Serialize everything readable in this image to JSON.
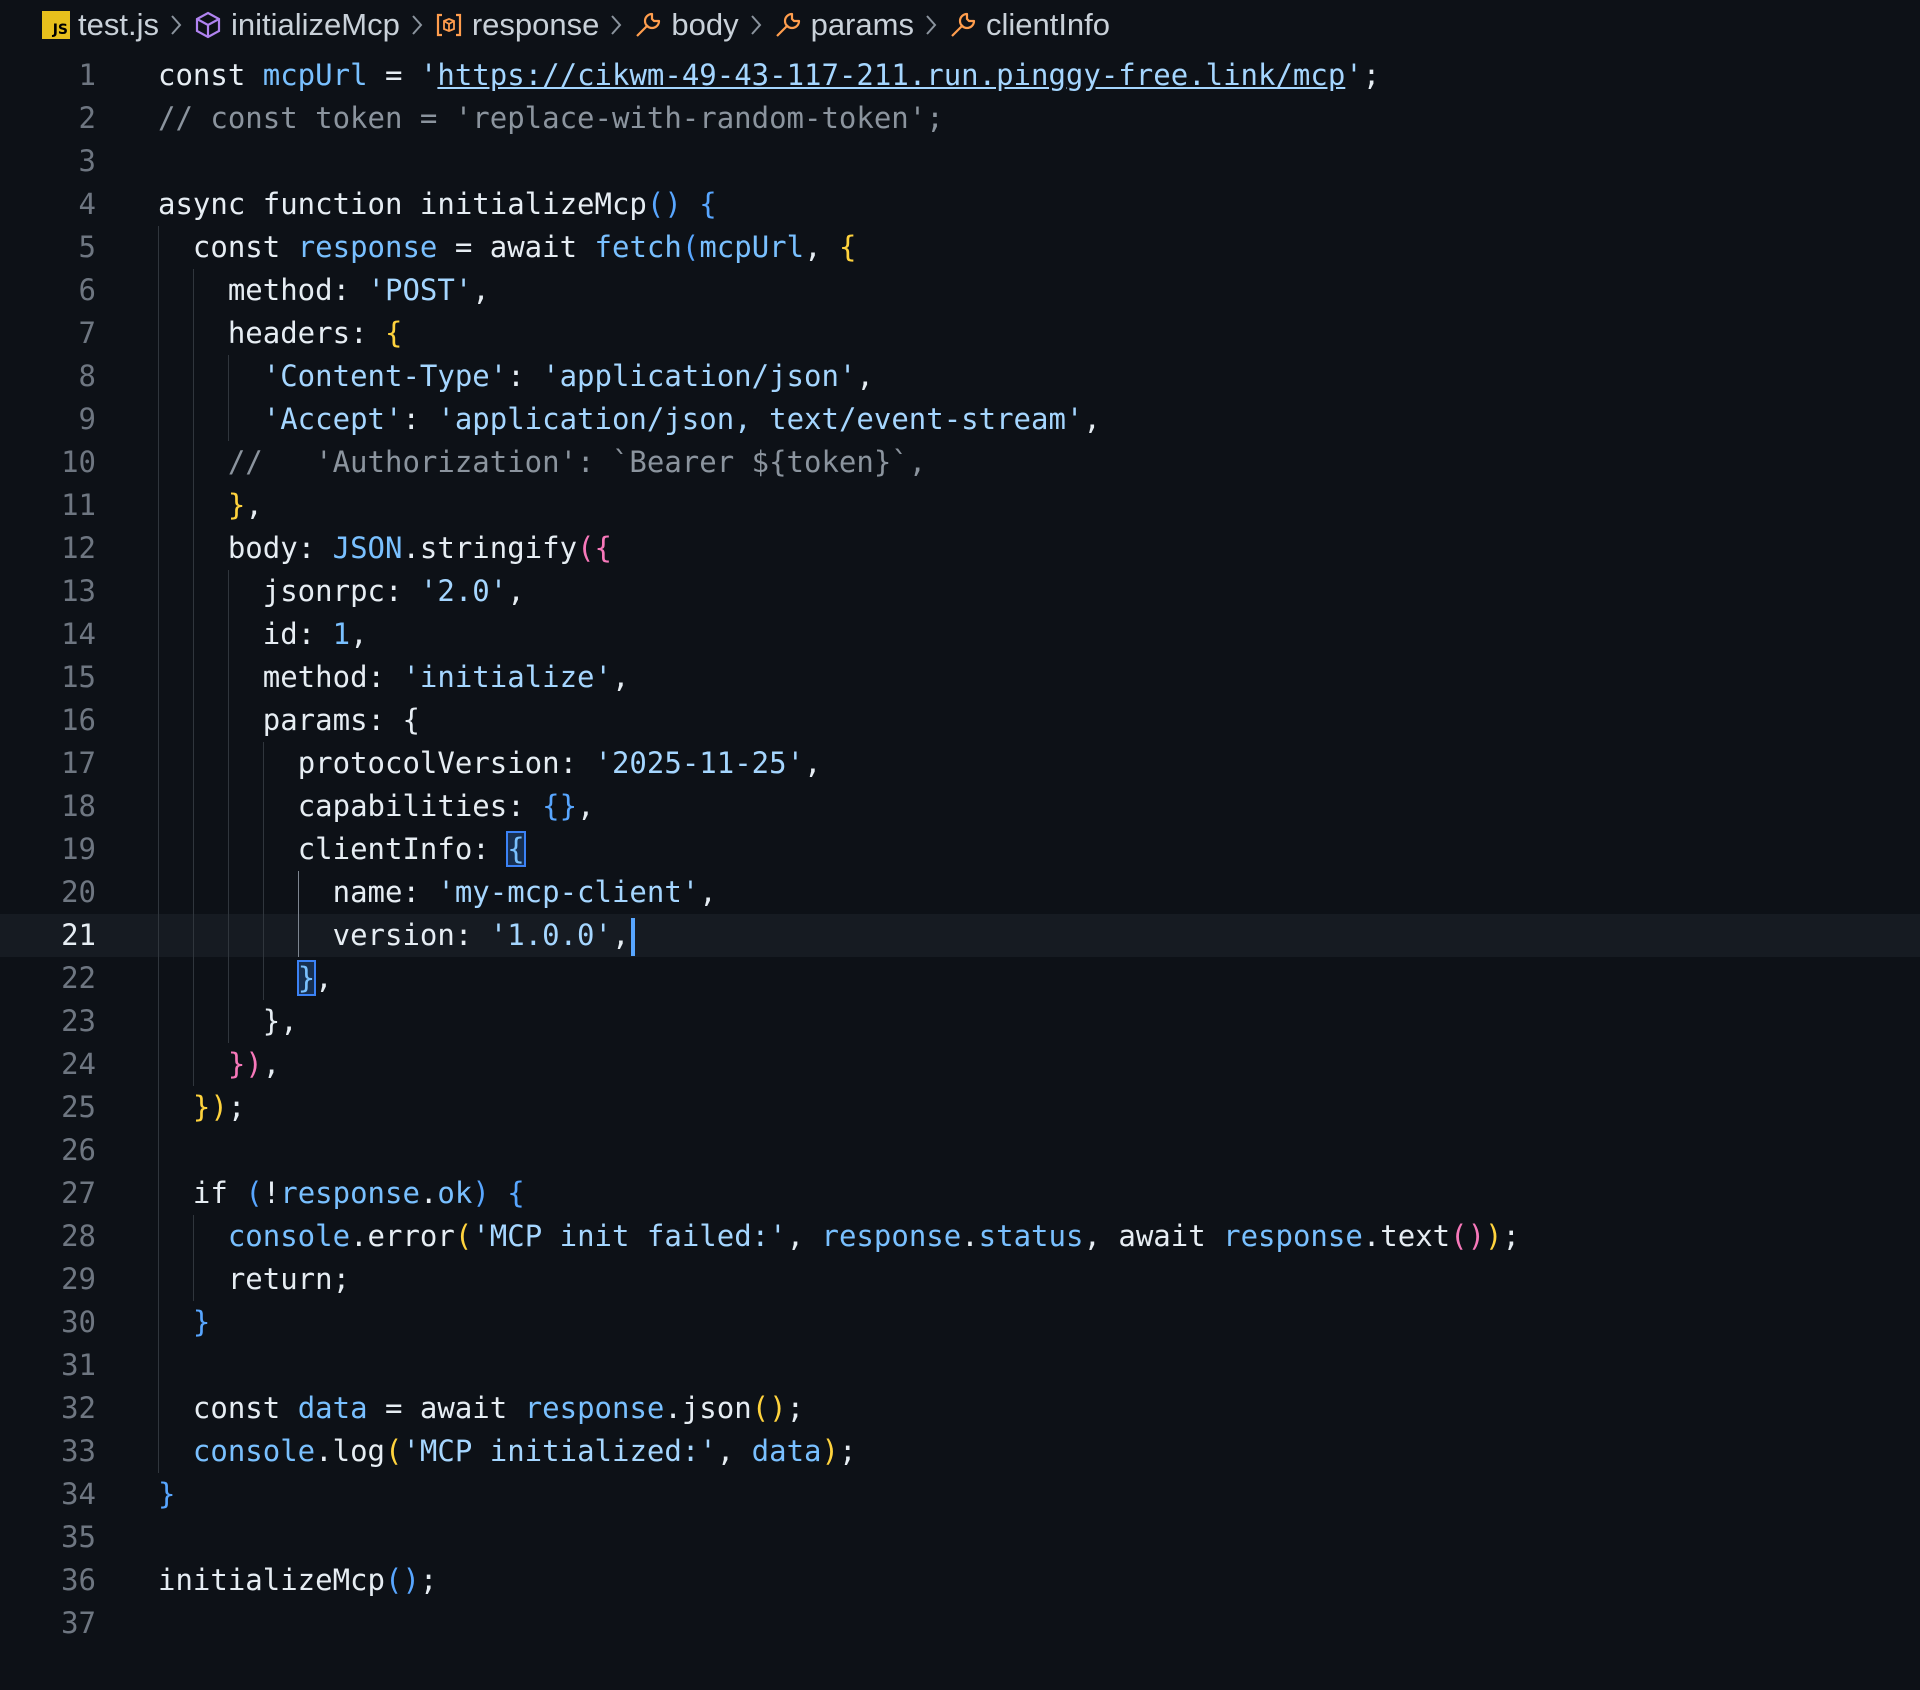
{
  "breadcrumb": {
    "file": "test.js",
    "items": [
      "initializeMcp",
      "response",
      "body",
      "params",
      "clientInfo"
    ]
  },
  "editor": {
    "current_line": 21,
    "lines": [
      {
        "n": "1",
        "tokens": [
          [
            "kw",
            "const "
          ],
          [
            "var",
            "mcpUrl"
          ],
          [
            "punc",
            " = "
          ],
          [
            "str",
            "'"
          ],
          [
            "url",
            "https://cikwm-49-43-117-211.run.pinggy-free.link/mcp"
          ],
          [
            "str",
            "'"
          ],
          [
            "punc",
            ";"
          ]
        ]
      },
      {
        "n": "2",
        "tokens": [
          [
            "com",
            "// const token = 'replace-with-random-token';"
          ]
        ]
      },
      {
        "n": "3",
        "tokens": []
      },
      {
        "n": "4",
        "tokens": [
          [
            "kw",
            "async function "
          ],
          [
            "fn",
            "initializeMcp"
          ],
          [
            "b3",
            "() {"
          ]
        ]
      },
      {
        "n": "5",
        "tokens": [
          [
            "punc",
            "  "
          ],
          [
            "kw",
            "const "
          ],
          [
            "var",
            "response"
          ],
          [
            "punc",
            " = "
          ],
          [
            "kw",
            "await "
          ],
          [
            "var",
            "fetch"
          ],
          [
            "b3",
            "("
          ],
          [
            "var",
            "mcpUrl"
          ],
          [
            "punc",
            ", "
          ],
          [
            "b1",
            "{"
          ]
        ]
      },
      {
        "n": "6",
        "tokens": [
          [
            "punc",
            "    "
          ],
          [
            "prop",
            "method"
          ],
          [
            "punc",
            ": "
          ],
          [
            "str",
            "'POST'"
          ],
          [
            "punc",
            ","
          ]
        ]
      },
      {
        "n": "7",
        "tokens": [
          [
            "punc",
            "    "
          ],
          [
            "prop",
            "headers"
          ],
          [
            "punc",
            ": "
          ],
          [
            "b1",
            "{"
          ]
        ]
      },
      {
        "n": "8",
        "tokens": [
          [
            "punc",
            "      "
          ],
          [
            "str",
            "'Content-Type'"
          ],
          [
            "punc",
            ": "
          ],
          [
            "str",
            "'application/json'"
          ],
          [
            "punc",
            ","
          ]
        ]
      },
      {
        "n": "9",
        "tokens": [
          [
            "punc",
            "      "
          ],
          [
            "str",
            "'Accept'"
          ],
          [
            "punc",
            ": "
          ],
          [
            "str",
            "'application/json, text/event-stream'"
          ],
          [
            "punc",
            ","
          ]
        ]
      },
      {
        "n": "10",
        "tokens": [
          [
            "punc",
            "    "
          ],
          [
            "com",
            "//   'Authorization': `Bearer ${token}`,"
          ]
        ]
      },
      {
        "n": "11",
        "tokens": [
          [
            "punc",
            "    "
          ],
          [
            "b1",
            "}"
          ],
          [
            "punc",
            ","
          ]
        ]
      },
      {
        "n": "12",
        "tokens": [
          [
            "punc",
            "    "
          ],
          [
            "prop",
            "body"
          ],
          [
            "punc",
            ": "
          ],
          [
            "var",
            "JSON"
          ],
          [
            "punc",
            "."
          ],
          [
            "fn",
            "stringify"
          ],
          [
            "b2",
            "("
          ],
          [
            "b2",
            "{"
          ]
        ]
      },
      {
        "n": "13",
        "tokens": [
          [
            "punc",
            "      "
          ],
          [
            "prop",
            "jsonrpc"
          ],
          [
            "punc",
            ": "
          ],
          [
            "str",
            "'2.0'"
          ],
          [
            "punc",
            ","
          ]
        ]
      },
      {
        "n": "14",
        "tokens": [
          [
            "punc",
            "      "
          ],
          [
            "prop",
            "id"
          ],
          [
            "punc",
            ": "
          ],
          [
            "num",
            "1"
          ],
          [
            "punc",
            ","
          ]
        ]
      },
      {
        "n": "15",
        "tokens": [
          [
            "punc",
            "      "
          ],
          [
            "prop",
            "method"
          ],
          [
            "punc",
            ": "
          ],
          [
            "str",
            "'initialize'"
          ],
          [
            "punc",
            ","
          ]
        ]
      },
      {
        "n": "16",
        "tokens": [
          [
            "punc",
            "      "
          ],
          [
            "prop",
            "params"
          ],
          [
            "punc",
            ": "
          ],
          [
            "fn",
            "{"
          ]
        ]
      },
      {
        "n": "17",
        "tokens": [
          [
            "punc",
            "        "
          ],
          [
            "prop",
            "protocolVersion"
          ],
          [
            "punc",
            ": "
          ],
          [
            "str",
            "'2025-11-25'"
          ],
          [
            "punc",
            ","
          ]
        ]
      },
      {
        "n": "18",
        "tokens": [
          [
            "punc",
            "        "
          ],
          [
            "prop",
            "capabilities"
          ],
          [
            "punc",
            ": "
          ],
          [
            "b3",
            "{}"
          ],
          [
            "punc",
            ","
          ]
        ]
      },
      {
        "n": "19",
        "tokens": [
          [
            "punc",
            "        "
          ],
          [
            "prop",
            "clientInfo"
          ],
          [
            "punc",
            ": "
          ],
          [
            "match",
            "{"
          ]
        ]
      },
      {
        "n": "20",
        "tokens": [
          [
            "punc",
            "          "
          ],
          [
            "prop",
            "name"
          ],
          [
            "punc",
            ": "
          ],
          [
            "str",
            "'my-mcp-client'"
          ],
          [
            "punc",
            ","
          ]
        ]
      },
      {
        "n": "21",
        "tokens": [
          [
            "punc",
            "          "
          ],
          [
            "prop",
            "version"
          ],
          [
            "punc",
            ": "
          ],
          [
            "str",
            "'1.0.0'"
          ],
          [
            "punc",
            ","
          ],
          [
            "cursor",
            ""
          ]
        ]
      },
      {
        "n": "22",
        "tokens": [
          [
            "punc",
            "        "
          ],
          [
            "match",
            "}"
          ],
          [
            "punc",
            ","
          ]
        ]
      },
      {
        "n": "23",
        "tokens": [
          [
            "punc",
            "      "
          ],
          [
            "fn",
            "}"
          ],
          [
            "punc",
            ","
          ]
        ]
      },
      {
        "n": "24",
        "tokens": [
          [
            "punc",
            "    "
          ],
          [
            "b2",
            "})"
          ],
          [
            "punc",
            ","
          ]
        ]
      },
      {
        "n": "25",
        "tokens": [
          [
            "punc",
            "  "
          ],
          [
            "b1",
            "})"
          ],
          [
            "punc",
            ";"
          ]
        ]
      },
      {
        "n": "26",
        "tokens": []
      },
      {
        "n": "27",
        "tokens": [
          [
            "punc",
            "  "
          ],
          [
            "kw",
            "if "
          ],
          [
            "b3",
            "("
          ],
          [
            "punc",
            "!"
          ],
          [
            "var",
            "response"
          ],
          [
            "punc",
            "."
          ],
          [
            "var",
            "ok"
          ],
          [
            "b3",
            ") {"
          ]
        ]
      },
      {
        "n": "28",
        "tokens": [
          [
            "punc",
            "    "
          ],
          [
            "var",
            "console"
          ],
          [
            "punc",
            "."
          ],
          [
            "fn",
            "error"
          ],
          [
            "b1",
            "("
          ],
          [
            "str",
            "'MCP init failed:'"
          ],
          [
            "punc",
            ", "
          ],
          [
            "var",
            "response"
          ],
          [
            "punc",
            "."
          ],
          [
            "var",
            "status"
          ],
          [
            "punc",
            ", "
          ],
          [
            "kw",
            "await "
          ],
          [
            "var",
            "response"
          ],
          [
            "punc",
            "."
          ],
          [
            "fn",
            "text"
          ],
          [
            "b2",
            "()"
          ],
          [
            "b1",
            ")"
          ],
          [
            "punc",
            ";"
          ]
        ]
      },
      {
        "n": "29",
        "tokens": [
          [
            "punc",
            "    "
          ],
          [
            "kw",
            "return"
          ],
          [
            "punc",
            ";"
          ]
        ]
      },
      {
        "n": "30",
        "tokens": [
          [
            "punc",
            "  "
          ],
          [
            "b3",
            "}"
          ]
        ]
      },
      {
        "n": "31",
        "tokens": []
      },
      {
        "n": "32",
        "tokens": [
          [
            "punc",
            "  "
          ],
          [
            "kw",
            "const "
          ],
          [
            "var",
            "data"
          ],
          [
            "punc",
            " = "
          ],
          [
            "kw",
            "await "
          ],
          [
            "var",
            "response"
          ],
          [
            "punc",
            "."
          ],
          [
            "fn",
            "json"
          ],
          [
            "b1",
            "()"
          ],
          [
            "punc",
            ";"
          ]
        ]
      },
      {
        "n": "33",
        "tokens": [
          [
            "punc",
            "  "
          ],
          [
            "var",
            "console"
          ],
          [
            "punc",
            "."
          ],
          [
            "fn",
            "log"
          ],
          [
            "b1",
            "("
          ],
          [
            "str",
            "'MCP initialized:'"
          ],
          [
            "punc",
            ", "
          ],
          [
            "var",
            "data"
          ],
          [
            "b1",
            ")"
          ],
          [
            "punc",
            ";"
          ]
        ]
      },
      {
        "n": "34",
        "tokens": [
          [
            "b3",
            "}"
          ]
        ]
      },
      {
        "n": "35",
        "tokens": []
      },
      {
        "n": "36",
        "tokens": [
          [
            "fn",
            "initializeMcp"
          ],
          [
            "b3",
            "()"
          ],
          [
            "punc",
            ";"
          ]
        ]
      },
      {
        "n": "37",
        "tokens": []
      }
    ]
  }
}
